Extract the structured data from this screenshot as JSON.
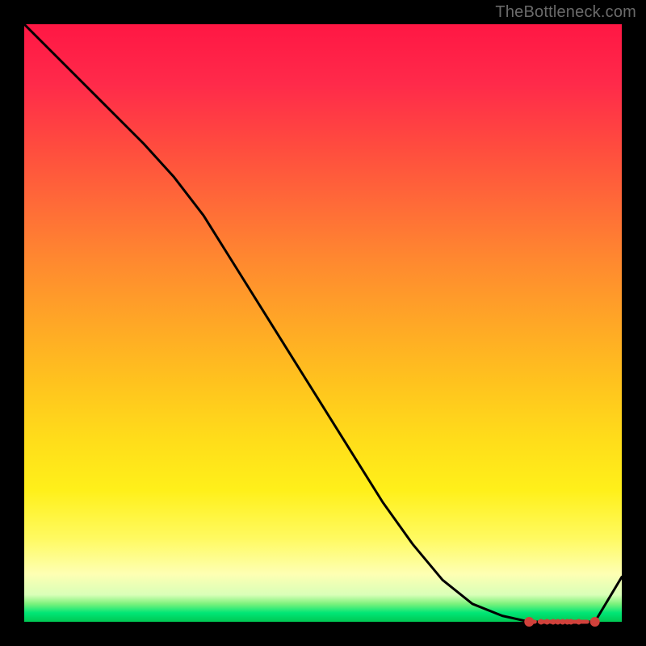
{
  "watermark": "TheBottleneck.com",
  "chart_data": {
    "type": "line",
    "title": "",
    "xlabel": "",
    "ylabel": "",
    "xlim": [
      0,
      100
    ],
    "ylim": [
      0,
      100
    ],
    "grid": false,
    "series": [
      {
        "name": "curve",
        "color": "#000000",
        "x": [
          0,
          5,
          10,
          15,
          20,
          25,
          30,
          35,
          40,
          45,
          50,
          55,
          60,
          65,
          70,
          75,
          80,
          84.5,
          86.5,
          95.5,
          100
        ],
        "values": [
          100,
          95,
          90,
          85,
          80,
          74.5,
          68,
          60,
          52,
          44,
          36,
          28,
          20,
          13,
          7,
          3,
          1,
          0,
          0,
          0,
          7.5
        ]
      }
    ],
    "markers": {
      "name": "highlight-points",
      "color": "#d0413b",
      "shape": "circle",
      "x": [
        84.5,
        86.5,
        87.5,
        88.5,
        89.3,
        90.1,
        90.9,
        91.5,
        92.8,
        95.5
      ],
      "values": [
        0,
        0,
        0,
        0,
        0,
        0,
        0,
        0,
        0,
        0
      ]
    },
    "gradient_stops": [
      {
        "pos": 0.0,
        "color": "#ff1744"
      },
      {
        "pos": 0.5,
        "color": "#ffa726"
      },
      {
        "pos": 0.78,
        "color": "#fff01a"
      },
      {
        "pos": 0.92,
        "color": "#feffb3"
      },
      {
        "pos": 0.97,
        "color": "#7cf27c"
      },
      {
        "pos": 1.0,
        "color": "#00c853"
      }
    ]
  }
}
